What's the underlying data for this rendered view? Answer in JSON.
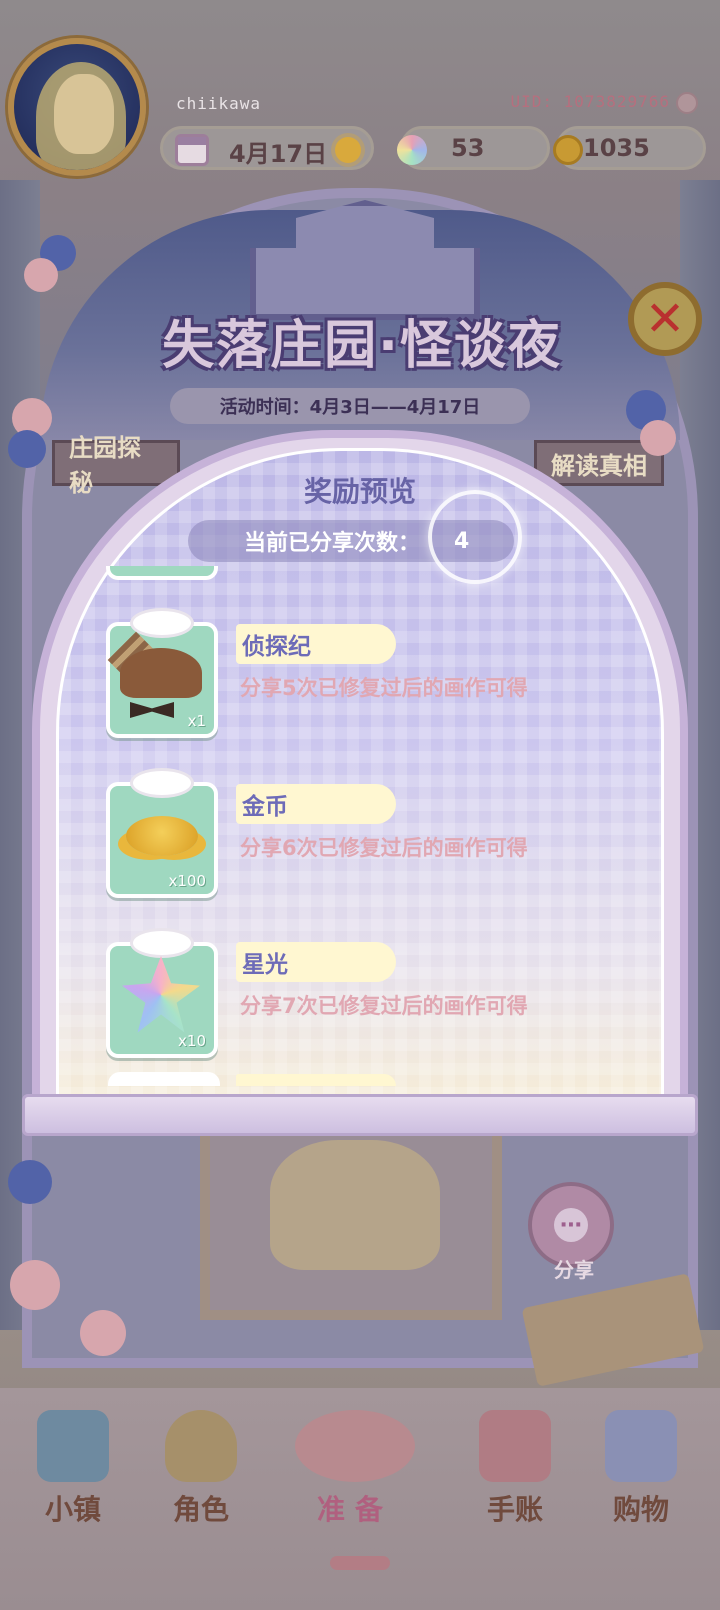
{
  "header": {
    "username": "chiikawa",
    "uid": "UID: 1073829766",
    "date": "4月17日",
    "stars": "53",
    "coins": "1035"
  },
  "event": {
    "title": "失落庄园·怪谈夜",
    "time": "活动时间：4月3日——4月17日",
    "tab_left": "庄园探秘",
    "tab_right": "解读真相",
    "share_label": "分享"
  },
  "popup": {
    "title": "奖励预览",
    "share_count_label": "当前已分享次数：",
    "share_count_value": "4",
    "rewards": [
      {
        "name": "侦探纪",
        "desc": "分享5次已修复过后的画作可得",
        "qty": "x1",
        "icon": "detective-outfit-icon"
      },
      {
        "name": "金币",
        "desc": "分享6次已修复过后的画作可得",
        "qty": "x100",
        "icon": "gold-coins-icon"
      },
      {
        "name": "星光",
        "desc": "分享7次已修复过后的画作可得",
        "qty": "x10",
        "icon": "starlight-icon"
      }
    ]
  },
  "nav": {
    "items": [
      {
        "label": "小镇",
        "icon": "map-icon"
      },
      {
        "label": "角色",
        "icon": "character-icon"
      },
      {
        "label": "准备",
        "icon": "prepare-icon"
      },
      {
        "label": "手账",
        "icon": "journal-icon"
      },
      {
        "label": "购物",
        "icon": "shopping-bag-icon"
      }
    ]
  },
  "colors": {
    "accent_purple": "#6763a6",
    "reward_card": "#9fd8c0",
    "name_tag": "#fff7d1",
    "desc_pink": "#e1a7b2",
    "nav_text": "#704a3d"
  }
}
